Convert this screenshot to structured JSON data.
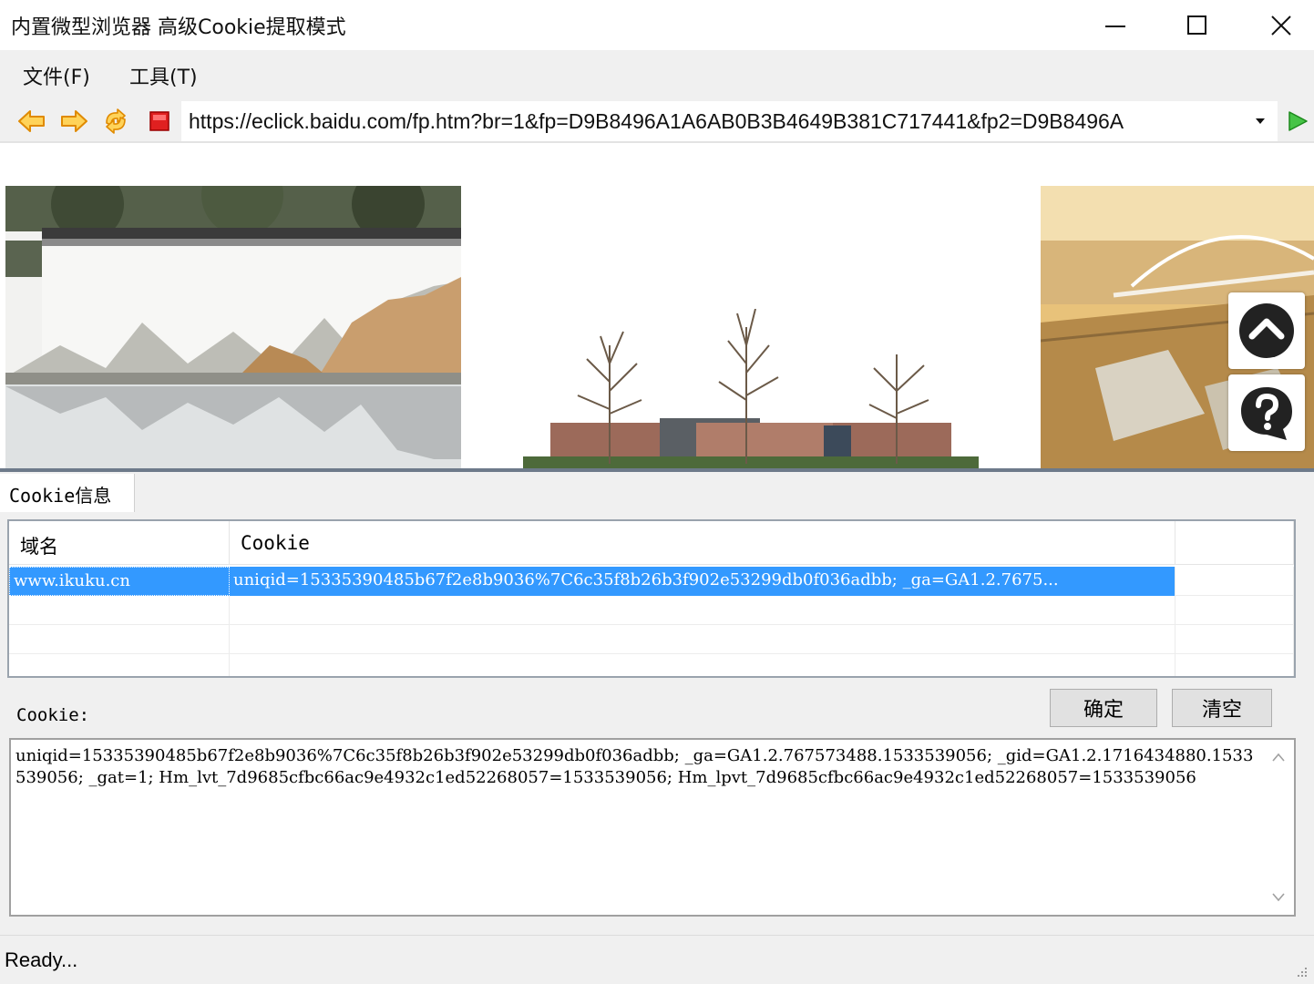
{
  "window": {
    "title": "内置微型浏览器 高级Cookie提取模式"
  },
  "menu": {
    "file": "文件(F)",
    "tools": "工具(T)"
  },
  "address": {
    "url": "https://eclick.baidu.com/fp.htm?br=1&fp=D9B8496A1A6AB0B3B4649B381C717441&fp2=D9B8496A"
  },
  "panel": {
    "tab_label": "Cookie信息",
    "columns": [
      "域名",
      "Cookie"
    ],
    "rows": [
      {
        "domain": "www.ikuku.cn",
        "cookie": "uniqid=15335390485b67f2e8b9036%7C6c35f8b26b3f902e53299db0f036adbb; _ga=GA1.2.7675..."
      }
    ],
    "cookie_label": "Cookie:",
    "ok_button": "确定",
    "clear_button": "清空",
    "cookie_text": "uniqid=15335390485b67f2e8b9036%7C6c35f8b26b3f902e53299db0f036adbb; _ga=GA1.2.767573488.1533539056; _gid=GA1.2.1716434880.1533539056; _gat=1; Hm_lvt_7d9685cfbc66ac9e4932c1ed52268057=1533539056; Hm_lpvt_7d9685cfbc66ac9e4932c1ed52268057=1533539056"
  },
  "status": {
    "text": "Ready..."
  },
  "colors": {
    "selection": "#3399ff",
    "nav_arrow": "#f5a623",
    "stop": "#e02020",
    "go": "#2eaa2e"
  }
}
